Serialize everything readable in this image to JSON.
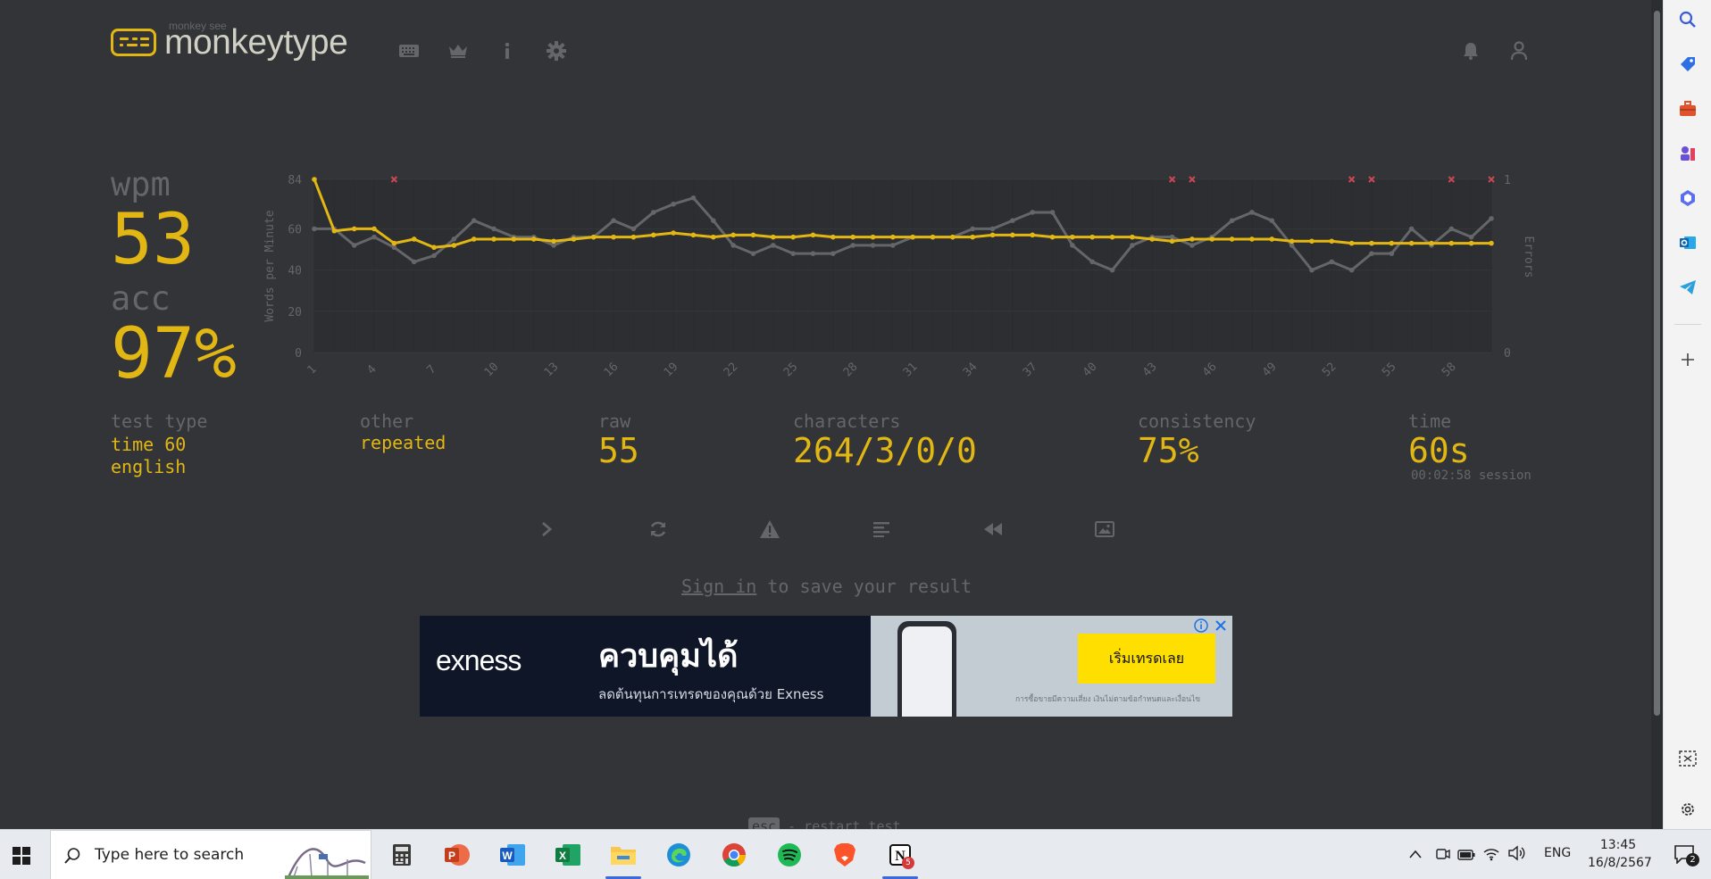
{
  "header": {
    "logo_sub": "monkey see",
    "logo_name": "monkeytype"
  },
  "stats": {
    "wpm_label": "wpm",
    "wpm_value": "53",
    "acc_label": "acc",
    "acc_value": "97%"
  },
  "details": {
    "test_type_label": "test type",
    "test_type_mode": "time 60",
    "test_type_lang": "english",
    "other_label": "other",
    "other_value": "repeated",
    "raw_label": "raw",
    "raw_value": "55",
    "characters_label": "characters",
    "characters_value": "264/3/0/0",
    "consistency_label": "consistency",
    "consistency_value": "75%",
    "time_label": "time",
    "time_value": "60s",
    "session_value": "00:02:58 session"
  },
  "signin": {
    "link": "Sign in",
    "rest": " to save your result"
  },
  "footer_hint": {
    "key": "esc",
    "text": "- restart test"
  },
  "ad": {
    "brand": "exness",
    "headline": "ควบคุมได้",
    "subline": "ลดต้นทุนการเทรดของคุณด้วย Exness",
    "cta": "เริ่มเทรดเลย",
    "disclaimer": "การซื้อขายมีความเสี่ยง เงินไม่ตามข้อกำหนดและเงื่อนไข"
  },
  "taskbar": {
    "search_placeholder": "Type here to search",
    "lang": "ENG",
    "time": "13:45",
    "date": "16/8/2567",
    "notif_count": "2",
    "notion_badge": "5"
  },
  "colors": {
    "background": "#323437",
    "main": "#e2b714",
    "sub": "#646669",
    "text": "#d1d0c5",
    "error": "#ca4754"
  },
  "chart_data": {
    "type": "line",
    "ylabel": "Words per Minute",
    "y2label": "Errors",
    "ylim": [
      0,
      84
    ],
    "y_ticks": [
      0,
      20,
      40,
      60,
      84
    ],
    "y2_ticks": [
      0,
      1
    ],
    "x_ticks": [
      1,
      4,
      7,
      10,
      13,
      16,
      19,
      22,
      25,
      28,
      31,
      34,
      37,
      40,
      43,
      46,
      49,
      52,
      55,
      58
    ],
    "x": [
      1,
      2,
      3,
      4,
      5,
      6,
      7,
      8,
      9,
      10,
      11,
      12,
      13,
      14,
      15,
      16,
      17,
      18,
      19,
      20,
      21,
      22,
      23,
      24,
      25,
      26,
      27,
      28,
      29,
      30,
      31,
      32,
      33,
      34,
      35,
      36,
      37,
      38,
      39,
      40,
      41,
      42,
      43,
      44,
      45,
      46,
      47,
      48,
      49,
      50,
      51,
      52,
      53,
      54,
      55,
      56,
      57,
      58,
      59,
      60
    ],
    "series": [
      {
        "name": "wpm",
        "color": "#e2b714",
        "values": [
          84,
          59,
          60,
          60,
          53,
          55,
          51,
          52,
          55,
          55,
          55,
          55,
          54,
          55,
          56,
          56,
          56,
          57,
          58,
          57,
          56,
          57,
          57,
          56,
          56,
          57,
          56,
          56,
          56,
          56,
          56,
          56,
          56,
          56,
          57,
          57,
          57,
          56,
          56,
          56,
          56,
          56,
          55,
          54,
          55,
          55,
          55,
          55,
          55,
          54,
          54,
          54,
          53,
          53,
          53,
          53,
          53,
          53,
          53,
          53
        ]
      },
      {
        "name": "raw",
        "color": "#646669",
        "values": [
          60,
          60,
          52,
          56,
          51,
          44,
          47,
          55,
          64,
          60,
          56,
          56,
          52,
          56,
          56,
          64,
          60,
          68,
          72,
          75,
          64,
          52,
          48,
          52,
          48,
          48,
          48,
          52,
          52,
          52,
          56,
          56,
          56,
          60,
          60,
          64,
          68,
          68,
          52,
          44,
          40,
          52,
          56,
          56,
          52,
          56,
          64,
          68,
          64,
          52,
          40,
          44,
          40,
          48,
          48,
          60,
          52,
          60,
          56,
          65
        ]
      },
      {
        "name": "errors",
        "color": "#ca4754",
        "error_at": [
          5,
          44,
          45,
          53,
          54,
          58,
          60
        ]
      }
    ]
  }
}
